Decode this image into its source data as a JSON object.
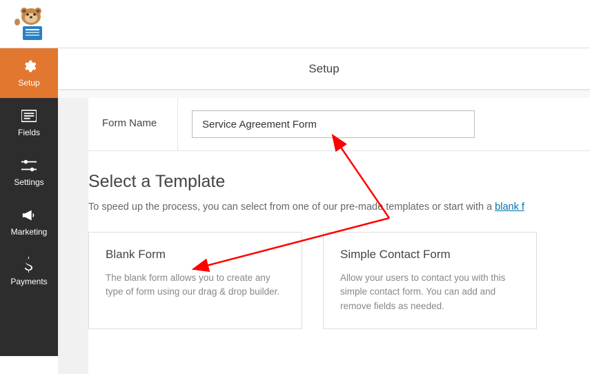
{
  "header": {
    "tab_title": "Setup"
  },
  "sidebar": {
    "items": [
      {
        "label": "Setup",
        "icon": "gear"
      },
      {
        "label": "Fields",
        "icon": "list"
      },
      {
        "label": "Settings",
        "icon": "sliders"
      },
      {
        "label": "Marketing",
        "icon": "megaphone"
      },
      {
        "label": "Payments",
        "icon": "dollar"
      }
    ]
  },
  "form": {
    "name_label": "Form Name",
    "name_value": "Service Agreement Form"
  },
  "template": {
    "heading": "Select a Template",
    "description_prefix": "To speed up the process, you can select from one of our pre-made templates or start with a ",
    "link_text": "blank f",
    "cards": [
      {
        "title": "Blank Form",
        "desc": "The blank form allows you to create any type of form using our drag & drop builder."
      },
      {
        "title": "Simple Contact Form",
        "desc": "Allow your users to contact you with this simple contact form. You can add and remove fields as needed."
      }
    ]
  }
}
